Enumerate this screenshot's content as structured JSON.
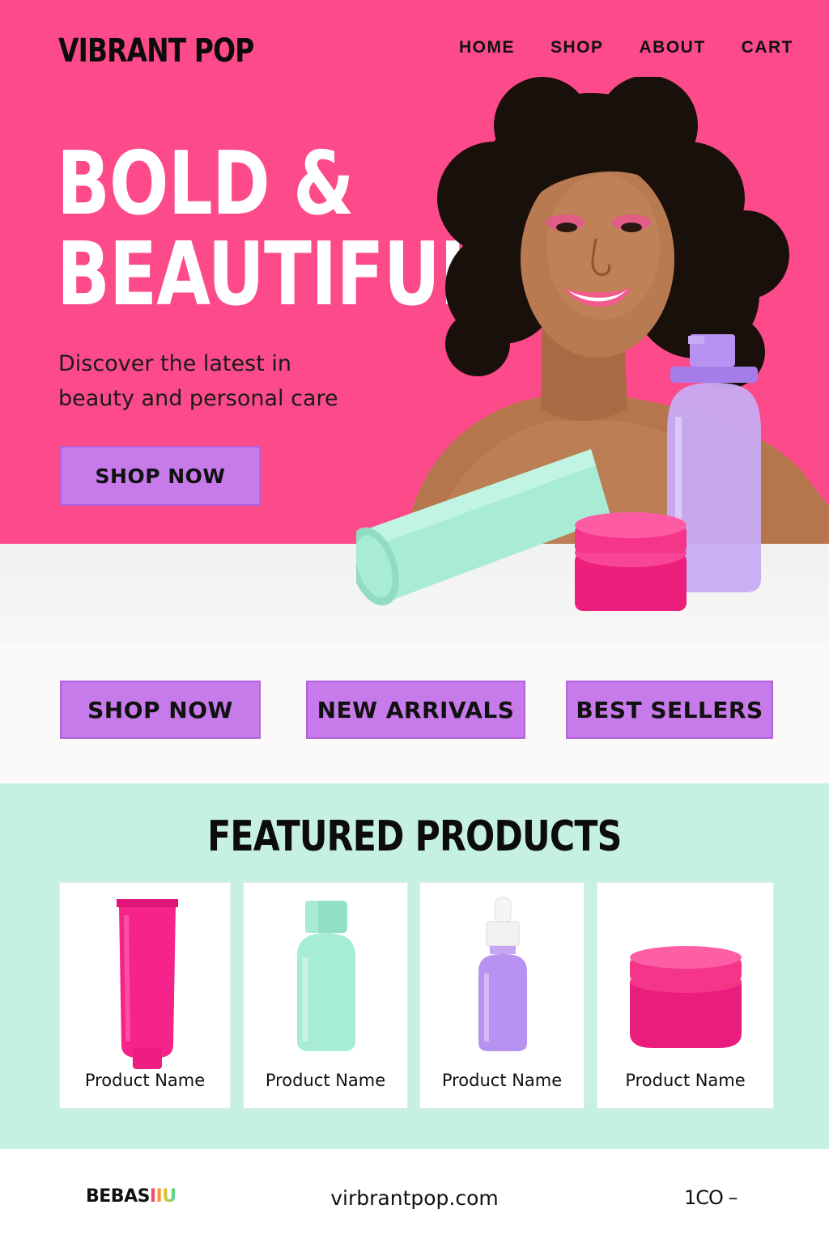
{
  "header": {
    "brand": "VIBRANT POP",
    "nav": [
      "HOME",
      "SHOP",
      "ABOUT",
      "CART"
    ]
  },
  "hero": {
    "headline_line1": "BOLD &",
    "headline_line2": "BEAUTIFUL",
    "subtitle_line1": "Discover the latest in",
    "subtitle_line2": "beauty and personal care",
    "cta": "SHOP NOW"
  },
  "cta_strip": {
    "buttons": [
      "SHOP NOW",
      "NEW ARRIVALS",
      "BEST SELLERS"
    ]
  },
  "featured": {
    "title": "FEATURED PRODUCTS",
    "products": [
      {
        "name": "Product Name",
        "icon": "pink-tube-icon"
      },
      {
        "name": "Product Name",
        "icon": "mint-bottle-icon"
      },
      {
        "name": "Product Name",
        "icon": "lavender-dropper-icon"
      },
      {
        "name": "Product Name",
        "icon": "pink-jar-icon"
      }
    ]
  },
  "footer": {
    "logo_left": "BEBAS",
    "logo_right": "IIU",
    "url": "virbrantpop.com",
    "right_text": "1CO –"
  },
  "colors": {
    "hero_pink": "#fd4a8a",
    "button_purple": "#c77aea",
    "mint": "#c6f0e4",
    "product_pink": "#f5238a",
    "product_mint": "#a7ecd6",
    "product_lavender": "#b792f0"
  }
}
